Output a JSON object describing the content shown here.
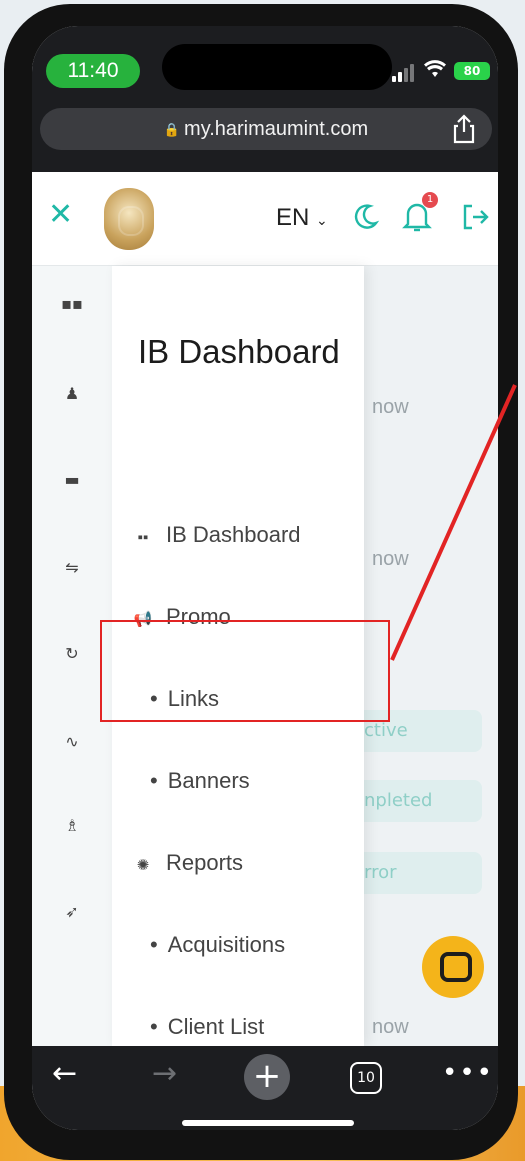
{
  "status": {
    "time": "11:40",
    "battery": "80"
  },
  "browser": {
    "url": "my.harimaumint.com",
    "tab_count": "10"
  },
  "header": {
    "language": "EN",
    "notification_count": "1"
  },
  "drawer": {
    "title": "IB Dashboard",
    "items": [
      {
        "label": "IB Dashboard",
        "icon": "grid-icon"
      },
      {
        "label": "Promo",
        "icon": "megaphone-icon"
      },
      {
        "label": "Links",
        "sub": true
      },
      {
        "label": "Banners",
        "sub": true
      },
      {
        "label": "Reports",
        "icon": "spinner-icon"
      },
      {
        "label": "Acquisitions",
        "sub": true
      },
      {
        "label": "Client List",
        "sub": true
      }
    ]
  },
  "background": {
    "peek_1": "now",
    "peek_2": "now",
    "peek_3": "now",
    "status_1": "ctive",
    "status_2": "npleted",
    "status_3": "rror"
  },
  "colors": {
    "accent": "#1fb8a6",
    "highlight": "#e22424",
    "chat": "#f4b41a"
  }
}
